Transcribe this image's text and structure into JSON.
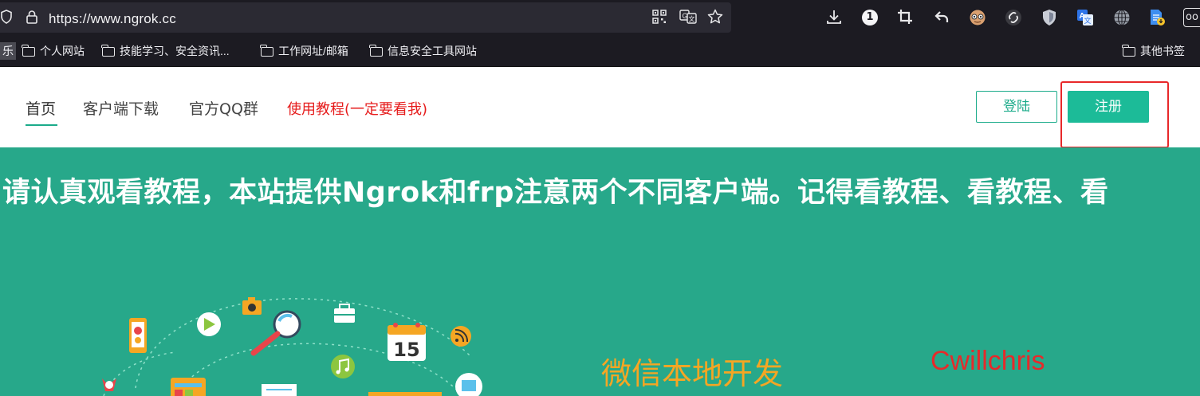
{
  "browser": {
    "url": "https://www.ngrok.cc",
    "extension_badge": "1"
  },
  "bookmarks": {
    "partial_item": "乐",
    "items": [
      {
        "label": "个人网站"
      },
      {
        "label": "技能学习、安全资讯..."
      },
      {
        "label": "工作网址/邮箱"
      },
      {
        "label": "信息安全工具网站"
      }
    ],
    "other": "其他书签"
  },
  "nav": {
    "items": [
      {
        "label": "首页",
        "active": true
      },
      {
        "label": "客户端下载"
      },
      {
        "label": "官方QQ群"
      },
      {
        "label": "使用教程(一定要看我)",
        "color": "#e61c1c"
      }
    ],
    "login_label": "登陆",
    "register_label": "注册"
  },
  "banner": {
    "marquee": "请认真观看教程，本站提供Ngrok和frp注意两个不同客户端。记得看教程、看教程、看",
    "calendar_day": "15",
    "wechat_title": "微信本地开发",
    "author": "Cwillchris"
  },
  "colors": {
    "brand": "#1bab8a",
    "banner_bg": "#27a88a",
    "highlight": "#e8282a"
  }
}
